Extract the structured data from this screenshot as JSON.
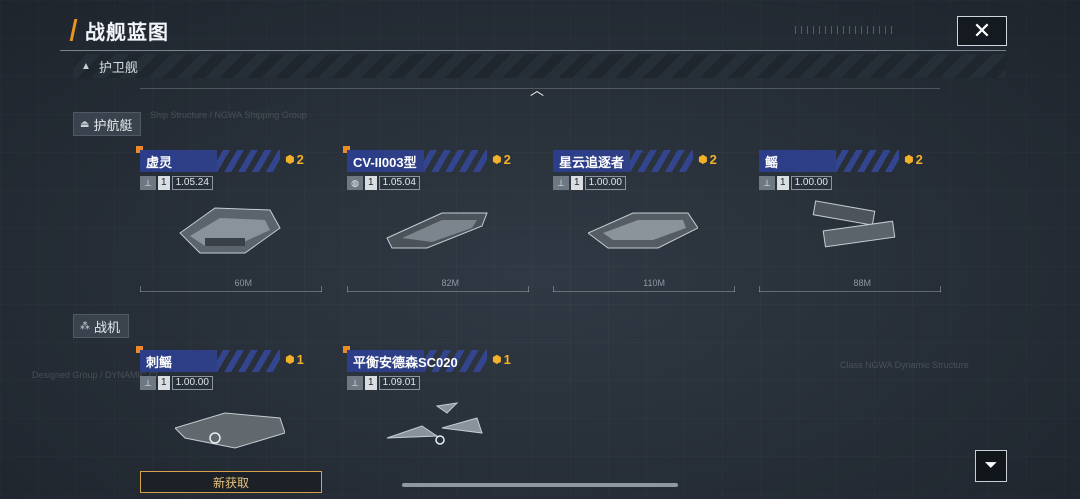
{
  "header": {
    "title": "战舰蓝图"
  },
  "category": {
    "label": "护卫舰"
  },
  "sections": [
    {
      "label": "护航艇",
      "cards": [
        {
          "name": "虚灵",
          "cost": "2",
          "level": "1",
          "version": "1.05.24",
          "length": "60M",
          "is_new": true
        },
        {
          "name": "CV-II003型",
          "cost": "2",
          "level": "1",
          "version": "1.05.04",
          "length": "82M",
          "is_new": true
        },
        {
          "name": "星云追逐者",
          "cost": "2",
          "level": "1",
          "version": "1.00.00",
          "length": "110M",
          "is_new": false
        },
        {
          "name": "鳐",
          "cost": "2",
          "level": "1",
          "version": "1.00.00",
          "length": "88M",
          "is_new": false
        }
      ]
    },
    {
      "label": "战机",
      "cards": [
        {
          "name": "刺鳐",
          "cost": "1",
          "level": "1",
          "version": "1.00.00",
          "badge": "新获取",
          "is_new": true
        },
        {
          "name": "平衡安德森SC020",
          "cost": "1",
          "level": "1",
          "version": "1.09.01",
          "is_new": true
        }
      ]
    }
  ],
  "colors": {
    "accent": "#e8941f",
    "header_blue": "#2c3d8a",
    "cost_gold": "#f3b02a",
    "new_flag": "#ef8a2a"
  }
}
